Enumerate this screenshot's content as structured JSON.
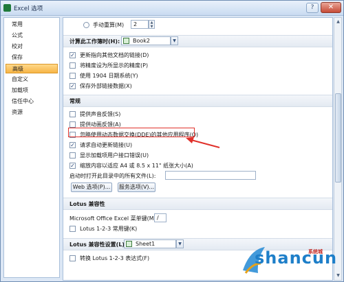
{
  "window": {
    "title": "Excel 选项",
    "help": "?",
    "close": "✕"
  },
  "sidebar": {
    "items": [
      {
        "label": "常用"
      },
      {
        "label": "公式"
      },
      {
        "label": "校对"
      },
      {
        "label": "保存"
      },
      {
        "label": "高级",
        "selected": true
      },
      {
        "label": "自定义"
      },
      {
        "label": "加载项"
      },
      {
        "label": "信任中心"
      },
      {
        "label": "资源"
      }
    ]
  },
  "top": {
    "manual_recalc_label": "手动重算(M)",
    "manual_recalc_value": "2"
  },
  "calc_section": {
    "title": "计算此工作簿时(H):",
    "workbook": "Book2",
    "options": [
      {
        "label": "更新指向其他文档的链接(D)",
        "checked": true
      },
      {
        "label": "将精度设为所显示的精度(P)",
        "checked": false
      },
      {
        "label": "使用 1904 日期系统(Y)",
        "checked": false
      },
      {
        "label": "保存外部链接数据(X)",
        "checked": true
      }
    ]
  },
  "general_section": {
    "title": "常规",
    "options": [
      {
        "label": "提供声音反馈(S)",
        "checked": false
      },
      {
        "label": "提供动画反馈(A)",
        "checked": false
      },
      {
        "label": "忽略使用动态数据交换(DDE)的其他应用程序(O)",
        "checked": false
      },
      {
        "label": "请求自动更新链接(U)",
        "checked": true
      },
      {
        "label": "显示加载项用户接口错误(U)",
        "checked": false
      },
      {
        "label": "缩放内容以适应 A4 或 8.5 x 11\" 纸张大小(A)",
        "checked": true
      }
    ],
    "startup_label": "启动时打开此目录中的所有文件(L):",
    "startup_value": "",
    "web_button": "Web 选项(P)...",
    "service_button": "服务选项(V)..."
  },
  "lotus_section": {
    "title": "Lotus 兼容性",
    "menu_key_label": "Microsoft Office Excel 菜单键(M):",
    "menu_key_value": "/",
    "nav_keys_label": "Lotus 1-2-3 常用键(K)",
    "nav_keys_checked": false
  },
  "lotus_settings": {
    "title": "Lotus 兼容性设置(L):",
    "sheet": "Sheet1",
    "formula_label": "转换 Lotus 1-2-3 表达式(F)",
    "formula_checked": false
  },
  "watermark": {
    "text": "shancun",
    "site": "系统城"
  },
  "colors": {
    "accent": "#f7b546",
    "highlight": "#e0302a",
    "watermark": "#1e7fc9"
  }
}
